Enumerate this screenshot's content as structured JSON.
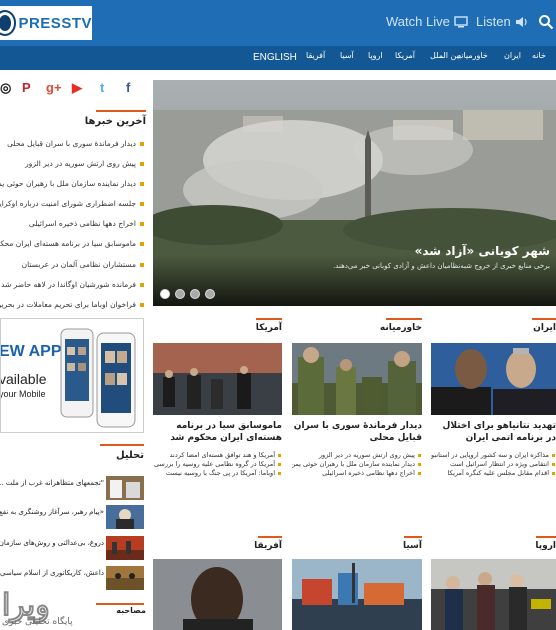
{
  "header": {
    "logo_text": "PRESSTV",
    "watch_live": "Watch Live",
    "listen": "Listen"
  },
  "nav": {
    "items": [
      "خانه",
      "ایران",
      "خاورمیانه",
      "بین‌ الملل",
      "آمریکا",
      "اروپا",
      "آسیا",
      "آفریقا"
    ],
    "english": "ENGLISH"
  },
  "social": [
    "f",
    "t",
    "▶",
    "g+",
    "P",
    "◎"
  ],
  "latest": {
    "title": "آخرین خبرها",
    "items": [
      "دیدار فرماندهٔ سوری با سران قبایل محلی",
      "پیش روی ارتش سوریه در دیر الزور",
      "دیدار نماینده سازمان ملل با رهبران حوثی یمن",
      "جلسه اضطراری شورای امنیت درباره اوکراین",
      "اخراج دهها نظامی ذخیره اسرائیلی",
      "ماموسابق سیا در برنامه هسته‌ای ایران محکوم شد",
      "مستشاران نظامی آلمان در عربستان",
      "فرمانده شورشیان اوگاندا در لاهه حاضر شد",
      "فراخوان اوباما برای تحریم معاملات در بحرین"
    ]
  },
  "slider": {
    "title": "شهر کوبانی «آزاد شد»",
    "subtitle": "برخی منابع خبری از خروج شبه‌نظامیان داعش و آزادی کوبانی خبر می‌دهند.",
    "dots": 4
  },
  "app_banner": {
    "line1": "EW APP",
    "line2": "vailable",
    "line3": "your Mobile"
  },
  "analysis": {
    "title": "تحلیل",
    "items": [
      "\"تجمعهای متظاهرانه غرب از ملت ... عبدالله\"",
      "«پیام رهبر، سرآغاز روشنگری به نفع اسلام»",
      "دروغ، بی‌عدالتی و روش‌های سازمان ...",
      "داعش، کاریکاتوری از اسلام سیاسی ..."
    ]
  },
  "interviews_title": "مصاحبه",
  "columns": [
    {
      "head": "آمریکا",
      "title": "ماموسابق سیا در برنامه هسته‌ای ایران محکوم شد",
      "bullets": [
        "آمریکا و هند توافق هسته‌ای امضا کردند",
        "آمریکا در گروه نظامی علیه روسیه را بررسی می‌کند",
        "اوباما: آمریکا در پی جنگ با روسیه نیست"
      ]
    },
    {
      "head": "خاورمیانه",
      "title": "دیدار فرماندهٔ سوری با سران قبایل محلی",
      "bullets": [
        "پیش روی ارتش سوریه در دیر الزور",
        "دیدار نماینده سازمان ملل با رهبران حوثی یمن",
        "اخراج دهها نظامی ذخیره اسرائیلی"
      ]
    },
    {
      "head": "ایران",
      "title": "تهدید نتانیاهو برای اختلال در برنامه اتمی ایران",
      "bullets": [
        "مذاکره ایران و سه کشور اروپایی در استانبول",
        "انتقامی ویژه در انتظار اسرائیل است",
        "اقدام مقابل مجلس علیه کنگره آمریکا"
      ]
    }
  ],
  "bottom_heads": [
    "آفریقا",
    "آسیا",
    "اروپا"
  ],
  "watermark": "ویرا",
  "watermark_sub": "پایگاه تحلیلی خبری"
}
